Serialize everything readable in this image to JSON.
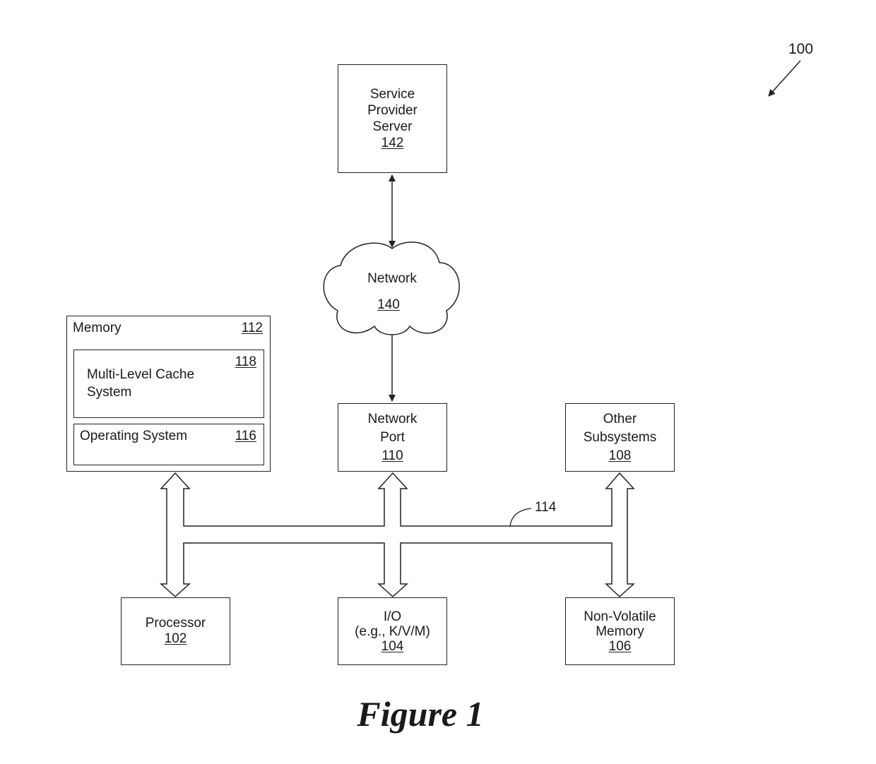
{
  "figure_ref": "100",
  "figure_caption": "Figure 1",
  "bus_ref": "114",
  "nodes": {
    "server": {
      "lines": [
        "Service",
        "Provider",
        "Server"
      ],
      "ref": "142"
    },
    "network": {
      "label": "Network",
      "ref": "140"
    },
    "memory": {
      "label": "Memory",
      "ref": "112",
      "cache": {
        "lines": [
          "Multi-Level Cache",
          "System"
        ],
        "ref": "118"
      },
      "os": {
        "label": "Operating System",
        "ref": "116"
      }
    },
    "network_port": {
      "lines": [
        "Network",
        "Port"
      ],
      "ref": "110"
    },
    "other_subsystems": {
      "lines": [
        "Other",
        "Subsystems"
      ],
      "ref": "108"
    },
    "processor": {
      "lines": [
        "Processor"
      ],
      "ref": "102"
    },
    "io": {
      "lines": [
        "I/O",
        "(e.g., K/V/M)"
      ],
      "ref": "104"
    },
    "nvm": {
      "lines": [
        "Non-Volatile",
        "Memory"
      ],
      "ref": "106"
    }
  },
  "colors": {
    "stroke": "#222222",
    "background": "#ffffff"
  }
}
